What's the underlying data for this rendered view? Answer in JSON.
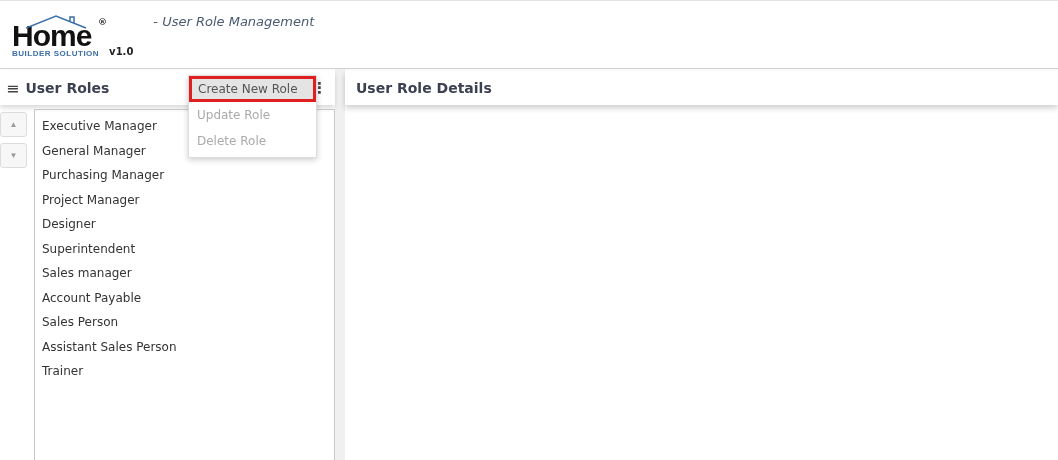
{
  "logo": {
    "word": "Home",
    "mark": "®",
    "tagline": "BUILDER SOLUTION",
    "version": "v1.0"
  },
  "page_title": "- User Role Management",
  "roles_panel": {
    "menu_icon": "≡",
    "title": "User Roles",
    "more_icon": "⋮",
    "menu": [
      {
        "label": "Create New Role",
        "disabled": false,
        "highlighted": true
      },
      {
        "label": "Update Role",
        "disabled": true,
        "highlighted": false
      },
      {
        "label": "Delete Role",
        "disabled": true,
        "highlighted": false
      }
    ],
    "move_buttons": [
      "▲",
      "▼"
    ],
    "roles": [
      "Executive Manager",
      "General Manager",
      "Purchasing Manager",
      "Project Manager",
      "Designer",
      "Superintendent",
      "Sales manager",
      "Account Payable",
      "Sales Person",
      "Assistant Sales Person",
      "Trainer"
    ]
  },
  "details_panel": {
    "title": "User Role Details"
  }
}
